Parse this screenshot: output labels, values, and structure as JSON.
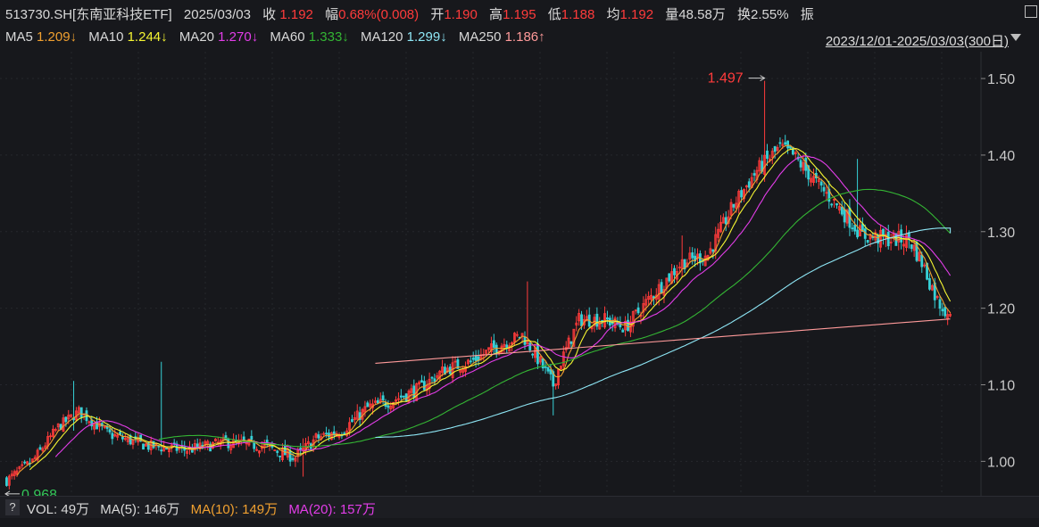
{
  "quote": {
    "symbol": "513730.SH[东南亚科技ETF]",
    "date": "2025/03/03",
    "close_label": "收",
    "close": "1.192",
    "change_label": "幅",
    "change": "0.68%(0.008)",
    "open_label": "开",
    "open": "1.190",
    "high_label": "高",
    "high": "1.195",
    "low_label": "低",
    "low": "1.188",
    "avg_label": "均",
    "avg": "1.192",
    "volume_label": "量",
    "volume": "48.58万",
    "turnover_label": "换",
    "turnover": "2.55%",
    "amp_label": "振"
  },
  "ma_legend": [
    {
      "label": "MA5",
      "value": "1.209↓",
      "color": "#f0a030"
    },
    {
      "label": "MA10",
      "value": "1.244↓",
      "color": "#f5f532"
    },
    {
      "label": "MA20",
      "value": "1.270↓",
      "color": "#e23de8"
    },
    {
      "label": "MA60",
      "value": "1.333↓",
      "color": "#34b534"
    },
    {
      "label": "MA120",
      "value": "1.299↓",
      "color": "#8ee6f5"
    },
    {
      "label": "MA250",
      "value": "1.186↑",
      "color": "#ff9a9a"
    }
  ],
  "range": "2023/12/01-2025/03/03(300日)",
  "chart_data": {
    "type": "candlestick",
    "y_ticks": [
      "1.50",
      "1.40",
      "1.30",
      "1.20",
      "1.10",
      "1.00"
    ],
    "ylim": [
      0.955,
      1.535
    ],
    "max_marker": "1.497",
    "min_marker": "0.968",
    "up_color": "#ff3b3b",
    "down_color": "#36d0d6",
    "n_bars": 300,
    "close_keypoints": [
      [
        0,
        0.975
      ],
      [
        10,
        1.0
      ],
      [
        20,
        1.045
      ],
      [
        28,
        1.065
      ],
      [
        40,
        1.035
      ],
      [
        55,
        1.02
      ],
      [
        70,
        1.015
      ],
      [
        85,
        1.025
      ],
      [
        100,
        1.02
      ],
      [
        112,
        1.005
      ],
      [
        120,
        1.03
      ],
      [
        130,
        1.04
      ],
      [
        140,
        1.07
      ],
      [
        150,
        1.08
      ],
      [
        160,
        1.095
      ],
      [
        170,
        1.12
      ],
      [
        180,
        1.13
      ],
      [
        190,
        1.15
      ],
      [
        200,
        1.165
      ],
      [
        205,
        1.14
      ],
      [
        212,
        1.1
      ],
      [
        215,
        1.13
      ],
      [
        222,
        1.185
      ],
      [
        232,
        1.185
      ],
      [
        240,
        1.175
      ],
      [
        250,
        1.215
      ],
      [
        262,
        1.26
      ],
      [
        272,
        1.27
      ],
      [
        282,
        1.335
      ],
      [
        291,
        1.38
      ],
      [
        300,
        1.41
      ],
      [
        305,
        1.4
      ],
      [
        315,
        1.36
      ],
      [
        322,
        1.335
      ],
      [
        332,
        1.295
      ],
      [
        342,
        1.29
      ],
      [
        350,
        1.29
      ],
      [
        355,
        1.26
      ],
      [
        361,
        1.21
      ],
      [
        366,
        1.192
      ]
    ],
    "spikes": [
      {
        "index": 294,
        "high": 1.497,
        "low": 1.4
      },
      {
        "index": 26,
        "high": 1.105,
        "low": 1.04
      },
      {
        "index": 60,
        "high": 1.13,
        "low": 1.01
      },
      {
        "index": 262,
        "high": 1.295,
        "low": 1.24
      },
      {
        "index": 330,
        "high": 1.395,
        "low": 1.33
      },
      {
        "index": 202,
        "high": 1.235,
        "low": 1.15
      },
      {
        "index": 212,
        "high": 1.12,
        "low": 1.06
      },
      {
        "index": 115,
        "high": 1.03,
        "low": 0.98
      }
    ],
    "ma_periods": [
      5,
      10,
      20,
      60,
      120
    ],
    "ma250_line": {
      "from_index": 143,
      "start": 1.128,
      "end": 1.186
    },
    "ma120_extend": 1.298
  },
  "volume_bar": {
    "help": "?",
    "vol": "VOL: 49万",
    "ma5": "MA(5): 146万",
    "ma10": "MA(10): 149万",
    "ma20": "MA(20): 157万",
    "ma5_color": "#dcdcdc",
    "ma10_color": "#f0a030",
    "ma20_color": "#e23de8"
  }
}
